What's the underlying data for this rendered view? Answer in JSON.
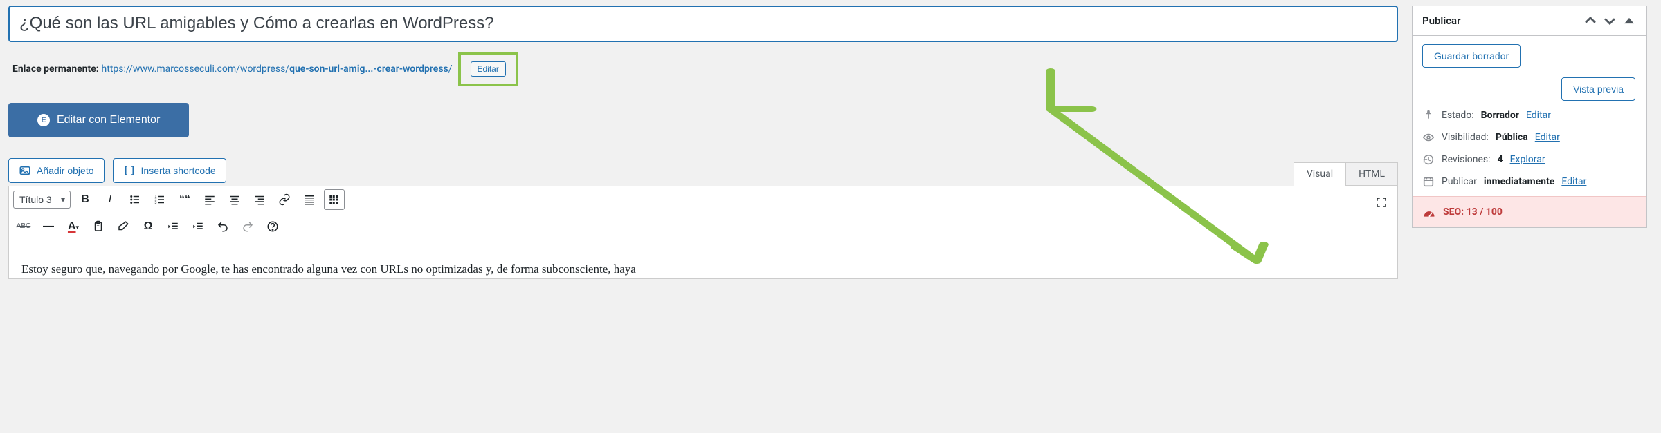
{
  "title": "¿Qué son las URL amigables y Cómo a crearlas en WordPress?",
  "permalink": {
    "label": "Enlace permanente:",
    "base": "https://www.marcosseculi.com/wordpress/",
    "slug": "que-son-url-amig...-crear-wordpress",
    "trail": "/",
    "edit_label": "Editar"
  },
  "elementor": {
    "label": "Editar con Elementor"
  },
  "media": {
    "add_object": "Añadir objeto",
    "insert_shortcode": "Inserta shortcode"
  },
  "editor": {
    "tabs": {
      "visual": "Visual",
      "html": "HTML"
    },
    "format_selected": "Título 3",
    "clear_fmt": "ABC",
    "text_color_letter": "A",
    "content_preview": "Estoy seguro que, navegando por Google, te has encontrado alguna vez con URLs no optimizadas y, de forma subconsciente, haya"
  },
  "sidebar": {
    "publish": {
      "title": "Publicar",
      "save_draft": "Guardar borrador",
      "preview": "Vista previa",
      "status_label": "Estado:",
      "status_value": "Borrador",
      "status_edit": "Editar",
      "visibility_label": "Visibilidad:",
      "visibility_value": "Pública",
      "visibility_edit": "Editar",
      "revisions_label": "Revisiones:",
      "revisions_value": "4",
      "revisions_link": "Explorar",
      "publish_label": "Publicar",
      "publish_value": "inmediatamente",
      "publish_edit": "Editar",
      "seo_label": "SEO:",
      "seo_score": "13 / 100"
    }
  },
  "colors": {
    "link": "#2271b1",
    "highlight": "#8bc34a",
    "danger_bg": "#fde6e6",
    "danger_fg": "#be3b3b"
  }
}
